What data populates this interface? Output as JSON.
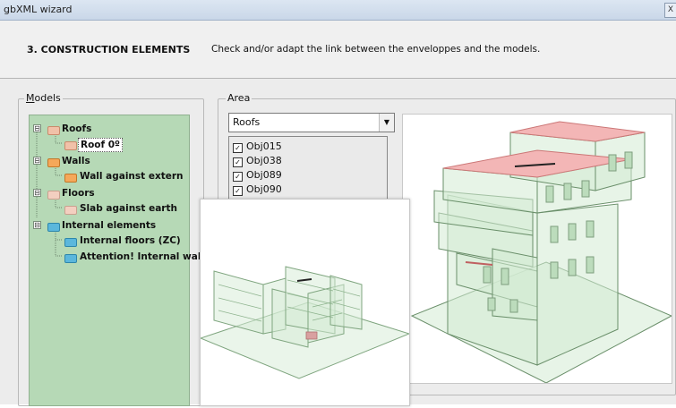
{
  "window": {
    "title": "gbXML wizard",
    "close_label": "X"
  },
  "header": {
    "step": "3.  CONSTRUCTION ELEMENTS",
    "description": "Check and/or adapt the link between the enveloppes and the models."
  },
  "models": {
    "legend": "odels",
    "legend_mnemonic": "M",
    "tree": [
      {
        "label": "Roofs",
        "expander": "⊟",
        "icon": "roof-icon"
      },
      {
        "label": "Roof 0º",
        "icon": "roof-icon",
        "selected": true
      },
      {
        "label": "Walls",
        "expander": "⊟",
        "icon": "wall-icon"
      },
      {
        "label": "Wall against extern",
        "icon": "wall-icon"
      },
      {
        "label": "Floors",
        "expander": "⊟",
        "icon": "floor-icon"
      },
      {
        "label": "Slab against earth",
        "icon": "floor-icon"
      },
      {
        "label": "Internal elements",
        "expander": "⊟",
        "icon": "internal-icon"
      },
      {
        "label": "Internal floors (ZC)",
        "icon": "internal-icon"
      },
      {
        "label": "Attention! Internal wall t",
        "icon": "internal-icon"
      }
    ]
  },
  "area": {
    "legend": "Area",
    "combo_value": "Roofs",
    "objects": [
      {
        "label": "Obj015",
        "checked": true
      },
      {
        "label": "Obj038",
        "checked": true
      },
      {
        "label": "Obj089",
        "checked": true
      },
      {
        "label": "Obj090",
        "checked": true
      }
    ]
  },
  "colors": {
    "tree_bg": "#b6d9b6",
    "model_fill": "#cfe8cf",
    "roof_highlight": "#f3b6b6"
  }
}
